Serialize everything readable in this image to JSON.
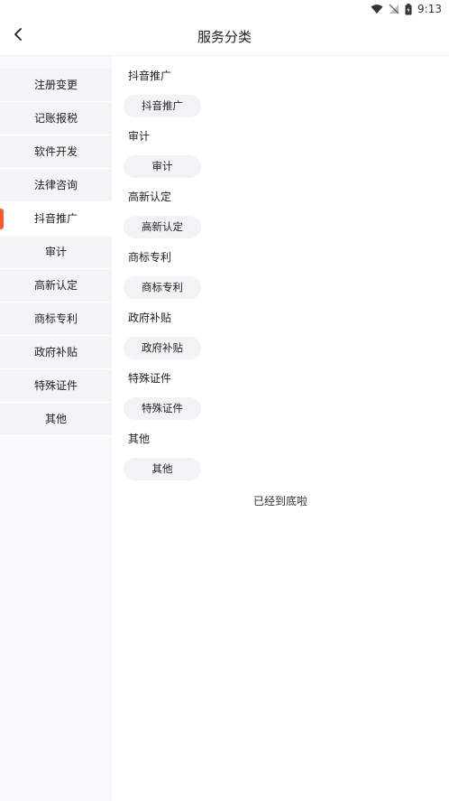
{
  "status_bar": {
    "time": "9:13"
  },
  "header": {
    "title": "服务分类"
  },
  "sidebar": {
    "items": [
      {
        "label": "注册变更",
        "active": false
      },
      {
        "label": "记账报税",
        "active": false
      },
      {
        "label": "软件开发",
        "active": false
      },
      {
        "label": "法律咨询",
        "active": false
      },
      {
        "label": "抖音推广",
        "active": true
      },
      {
        "label": "审计",
        "active": false
      },
      {
        "label": "高新认定",
        "active": false
      },
      {
        "label": "商标专利",
        "active": false
      },
      {
        "label": "政府补贴",
        "active": false
      },
      {
        "label": "特殊证件",
        "active": false
      },
      {
        "label": "其他",
        "active": false
      }
    ],
    "accent_color": "#ff5a2c"
  },
  "content": {
    "groups": [
      {
        "title": "抖音推广",
        "chips": [
          "抖音推广"
        ]
      },
      {
        "title": "审计",
        "chips": [
          "审计"
        ]
      },
      {
        "title": "高新认定",
        "chips": [
          "高新认定"
        ]
      },
      {
        "title": "商标专利",
        "chips": [
          "商标专利"
        ]
      },
      {
        "title": "政府补贴",
        "chips": [
          "政府补贴"
        ]
      },
      {
        "title": "特殊证件",
        "chips": [
          "特殊证件"
        ]
      },
      {
        "title": "其他",
        "chips": [
          "其他"
        ]
      }
    ],
    "end_text": "已经到底啦"
  },
  "icons": {
    "back": "chevron-left-icon",
    "wifi": "wifi-icon",
    "signal": "no-signal-icon",
    "battery": "battery-icon"
  }
}
